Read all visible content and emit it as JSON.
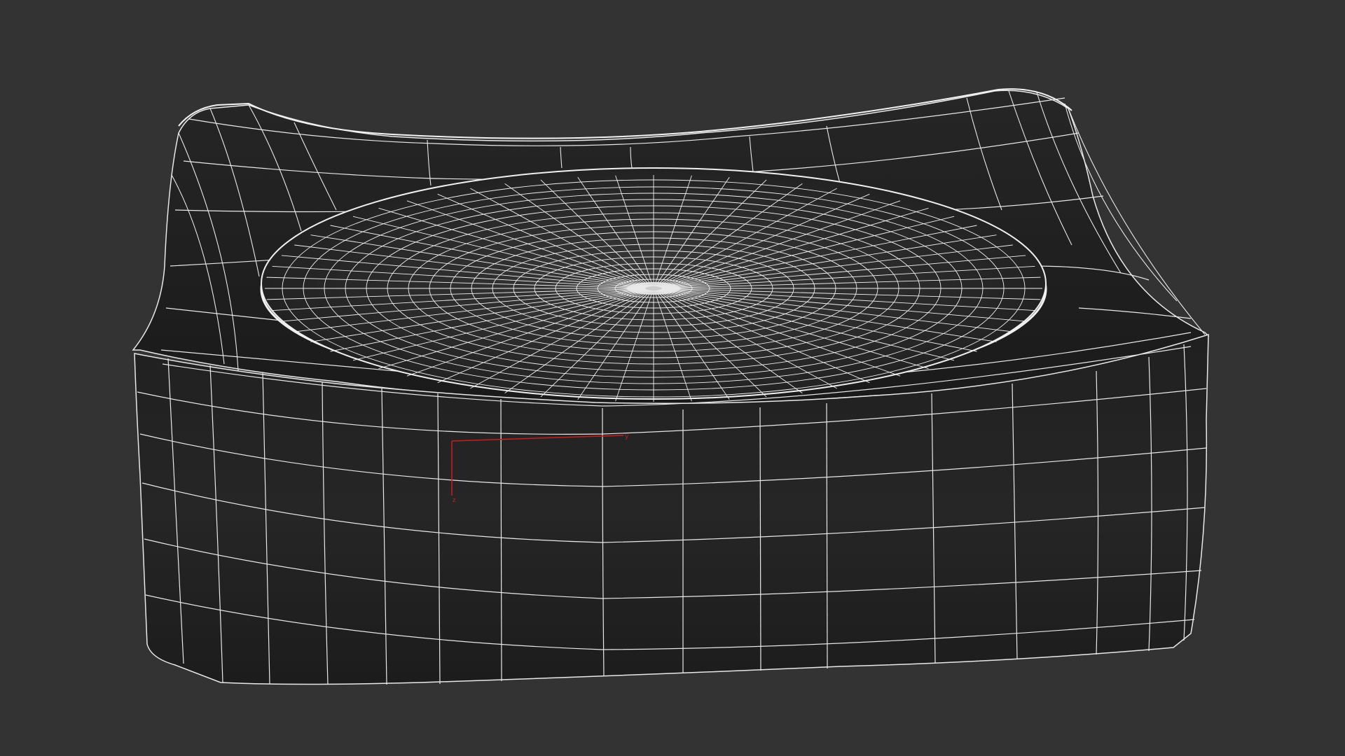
{
  "viewport": {
    "background": "#333333",
    "wire_color": "#e8e8e8",
    "surface_color": "#1e1e1e"
  },
  "gizmo": {
    "color": "#c81e1e",
    "axis_y_label": "y",
    "axis_z_label": "z"
  }
}
